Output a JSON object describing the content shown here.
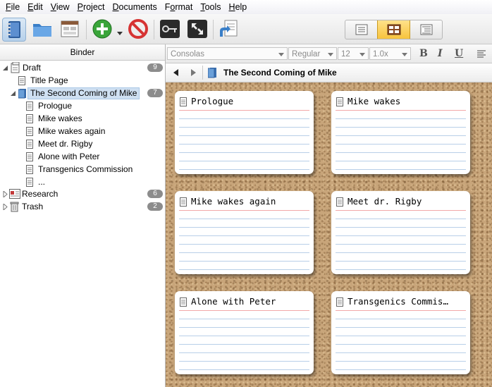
{
  "menu": [
    {
      "pre": "",
      "u": "F",
      "post": "ile"
    },
    {
      "pre": "",
      "u": "E",
      "post": "dit"
    },
    {
      "pre": "",
      "u": "V",
      "post": "iew"
    },
    {
      "pre": "",
      "u": "P",
      "post": "roject"
    },
    {
      "pre": "",
      "u": "D",
      "post": "ocuments"
    },
    {
      "pre": "F",
      "u": "o",
      "post": "rmat"
    },
    {
      "pre": "",
      "u": "T",
      "post": "ools"
    },
    {
      "pre": "",
      "u": "H",
      "post": "elp"
    }
  ],
  "binder": {
    "header": "Binder",
    "items": [
      {
        "label": "Draft",
        "badge": "9"
      },
      {
        "label": "Title Page"
      },
      {
        "label": "The Second Coming of Mike",
        "badge": "7"
      },
      {
        "label": "Prologue"
      },
      {
        "label": "Mike wakes"
      },
      {
        "label": "Mike wakes again"
      },
      {
        "label": "Meet dr. Rigby"
      },
      {
        "label": "Alone with Peter"
      },
      {
        "label": "Transgenics Commission"
      },
      {
        "label": "..."
      },
      {
        "label": "Research",
        "badge": "6"
      },
      {
        "label": "Trash",
        "badge": "2"
      }
    ]
  },
  "format": {
    "font": "Consolas",
    "style": "Regular",
    "size": "12",
    "spacing": "1.0x",
    "bold": "B",
    "italic": "I",
    "underline": "U"
  },
  "header": {
    "title": "The Second Coming of Mike"
  },
  "cards": [
    {
      "title": "Prologue"
    },
    {
      "title": "Mike wakes"
    },
    {
      "title": "Mike wakes again"
    },
    {
      "title": "Meet dr. Rigby"
    },
    {
      "title": "Alone with Peter"
    },
    {
      "title": "Transgenics Commis…"
    }
  ],
  "colors": {
    "selection": "#cfe0f2",
    "active_view": "#f7c33c",
    "cork": "#c8a57a"
  }
}
